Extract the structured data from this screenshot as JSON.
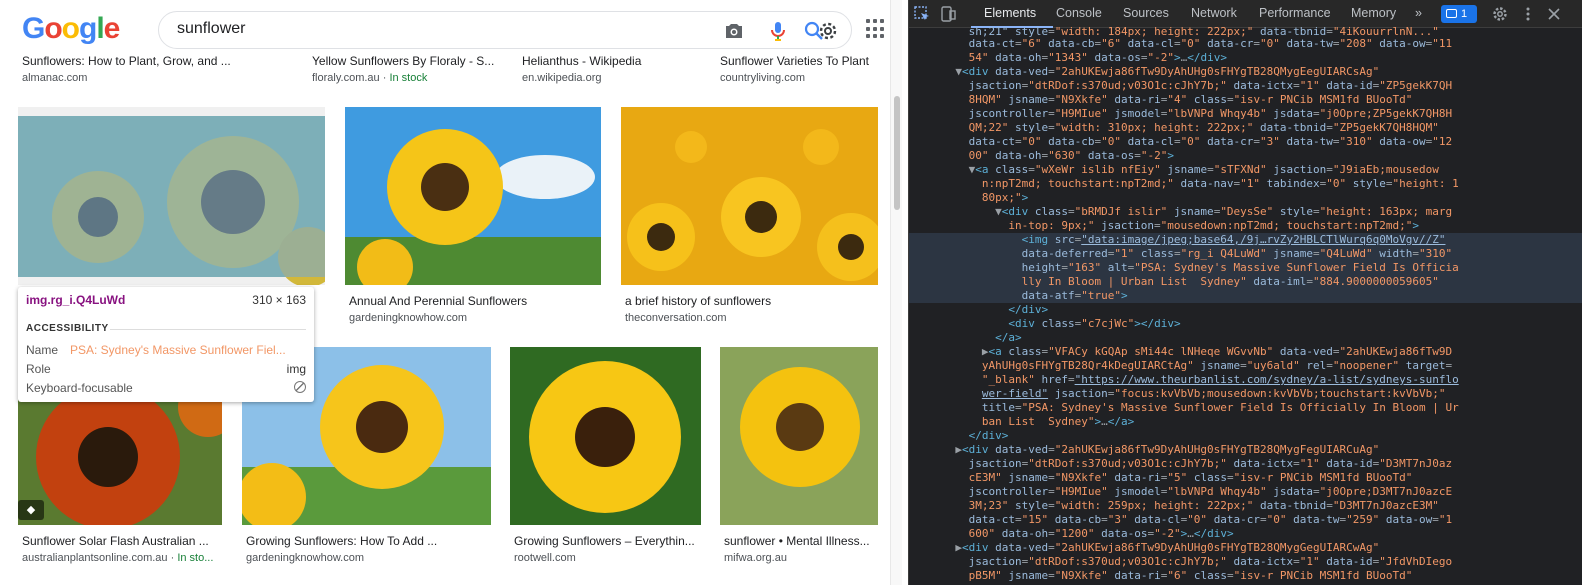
{
  "search": {
    "logo_letters": [
      "G",
      "o",
      "o",
      "g",
      "l",
      "e"
    ],
    "query": "sunflower",
    "icons": [
      "camera-icon",
      "mic-icon",
      "search-icon",
      "settings-icon",
      "apps-grid-icon"
    ]
  },
  "top_row": [
    {
      "title": "Sunflowers: How to Plant, Grow, and ...",
      "source": "almanac.com",
      "badge": ""
    },
    {
      "title": "Yellow Sunflowers By Floraly - S...",
      "source": "floraly.com.au",
      "badge": "In stock"
    },
    {
      "title": "Helianthus - Wikipedia",
      "source": "en.wikipedia.org",
      "badge": ""
    },
    {
      "title": "Sunflower Varieties To Plant",
      "source": "countryliving.com",
      "badge": ""
    }
  ],
  "row2": [
    {
      "title": "",
      "source": ""
    },
    {
      "title": "Annual And Perennial Sunflowers",
      "source": "gardeningknowhow.com"
    },
    {
      "title": "a brief history of sunflowers",
      "source": "theconversation.com"
    }
  ],
  "row3": [
    {
      "title": "Sunflower Solar Flash Australian ...",
      "source": "australianplantsonline.com.au",
      "badge": "In sto..."
    },
    {
      "title": "Growing Sunflowers: How To Add ...",
      "source": "gardeningknowhow.com",
      "badge": ""
    },
    {
      "title": "Growing Sunflowers – Everythin...",
      "source": "rootwell.com",
      "badge": ""
    },
    {
      "title": "sunflower • Mental Illness...",
      "source": "mifwa.org.au",
      "badge": ""
    }
  ],
  "tooltip": {
    "selector": "img.rg_i.Q4LuWd",
    "dims": "310 × 163",
    "section": "ACCESSIBILITY",
    "name_label": "Name",
    "name_value": "PSA: Sydney's Massive Sunflower Fiel...",
    "role_label": "Role",
    "role_value": "img",
    "focus_label": "Keyboard-focusable"
  },
  "devtools": {
    "tabs": [
      "Elements",
      "Console",
      "Sources",
      "Network",
      "Performance",
      "Memory"
    ],
    "more": "»",
    "issues_count": "1",
    "active_tab": "Elements"
  },
  "colors": {
    "highlight": "#6fa8dc",
    "link_blue": "#1a0dab",
    "stock_green": "#188038",
    "devtools_bg": "#202124"
  }
}
